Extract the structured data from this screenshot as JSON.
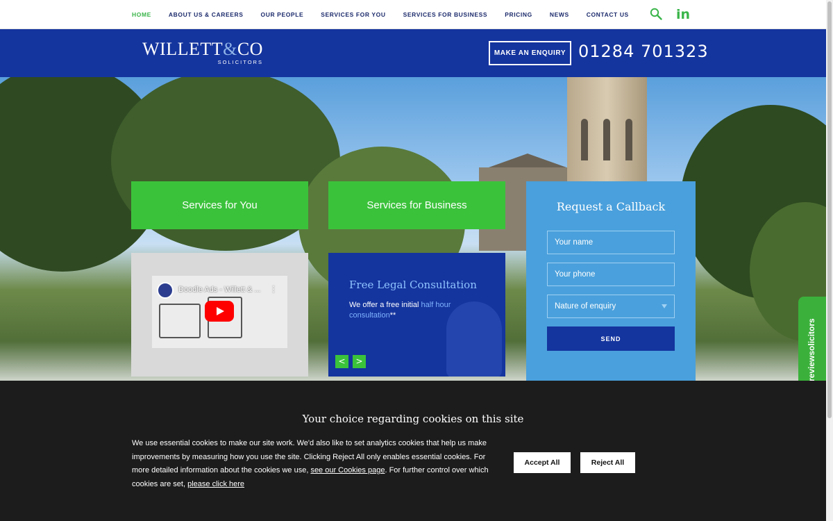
{
  "nav": {
    "items": [
      "HOME",
      "ABOUT US & CAREERS",
      "OUR PEOPLE",
      "SERVICES FOR YOU",
      "SERVICES FOR BUSINESS",
      "PRICING",
      "NEWS",
      "CONTACT US"
    ],
    "active": "HOME",
    "search_icon": "search-icon",
    "social_icon": "linkedin-icon",
    "social_label": "in"
  },
  "header": {
    "logo_main_a": "WILLETT",
    "logo_amp": "&",
    "logo_main_b": "CO",
    "logo_sub": "SOLICITORS",
    "enquiry_label": "MAKE AN ENQUIRY",
    "phone": "01284 701323"
  },
  "hero": {
    "tile_you": "Services for You",
    "tile_business": "Services for Business",
    "video_title": "Doodle Ads - Willett & ...",
    "video_menu": "⋮",
    "consult_title": "Free Legal Consultation",
    "consult_text_a": "We offer a free initial ",
    "consult_text_link": "half hour consultation",
    "consult_text_b": "**",
    "prev_label": "<",
    "next_label": ">"
  },
  "callback": {
    "title": "Request a Callback",
    "name_placeholder": "Your name",
    "phone_placeholder": "Your phone",
    "nature_placeholder": "Nature of enquiry",
    "send_label": "SEND"
  },
  "review_badge": {
    "label": "reviewsolicitors"
  },
  "cookie": {
    "title": "Your choice regarding cookies on this site",
    "text_a": "We use essential cookies to make our site work. We'd also like to set analytics cookies that help us make improvements by measuring how you use the site. Clicking Reject All only enables essential cookies. For more detailed information about the cookies we use, ",
    "link_cookies": "see our Cookies page",
    "text_b": ". For further control over which cookies are set, ",
    "link_click": "please click here",
    "accept_label": "Accept All",
    "reject_label": "Reject All"
  },
  "colors": {
    "brand_blue": "#14349e",
    "brand_green": "#3bc23b",
    "callback_blue": "#4aa0dc",
    "cookie_bg": "#1c1c1c"
  }
}
